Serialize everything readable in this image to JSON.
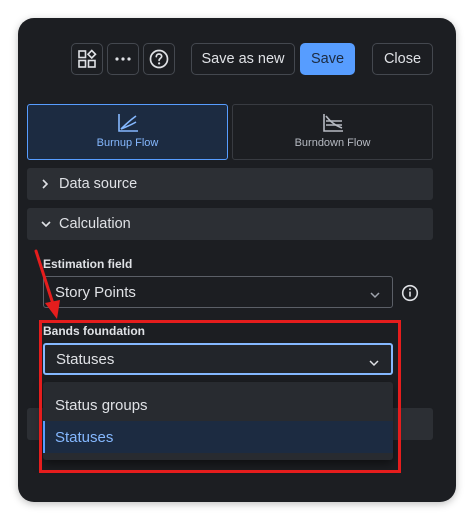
{
  "toolbar": {
    "save_as_new_label": "Save as new",
    "save_label": "Save",
    "close_label": "Close",
    "icons": [
      "widget-layout-icon",
      "more-icon",
      "help-icon"
    ]
  },
  "flow_options": [
    {
      "label": "Burnup Flow",
      "icon": "burnup-chart-icon",
      "selected": true
    },
    {
      "label": "Burndown Flow",
      "icon": "burndown-chart-icon",
      "selected": false
    }
  ],
  "sections": {
    "data_source": {
      "label": "Data source",
      "expanded": false
    },
    "calculation": {
      "label": "Calculation",
      "expanded": true
    }
  },
  "estimation_field": {
    "label": "Estimation field",
    "value": "Story Points"
  },
  "bands_foundation": {
    "label": "Bands foundation",
    "value": "Statuses",
    "options": [
      "Status groups",
      "Statuses"
    ],
    "selected_index": 1
  },
  "colors": {
    "accent": "#579dff",
    "panel_bg": "#1c1e22",
    "annotation": "#e51d1d"
  }
}
